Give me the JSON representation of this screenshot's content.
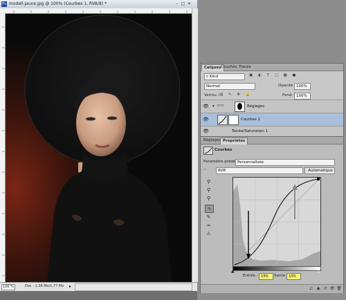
{
  "document": {
    "title": "modell-jaune.jpg @ 100% (Courbes 1, RVB/8) *",
    "app_logo": "Ps",
    "window_controls": [
      "–",
      "□",
      "✕"
    ],
    "zoom": "100 %",
    "doc_info": "Doc : 1,36 Mo/1,77 Mo"
  },
  "layers_panel": {
    "tabs": [
      "Calques",
      "Couches",
      "Tracés"
    ],
    "active_tab": "Calques",
    "kind_filter": "Kind",
    "blend_mode": "Normal",
    "opacity_label": "Opacité :",
    "opacity_value": "100%",
    "lock_label": "Verrou :",
    "fill_label": "Fond :",
    "fill_value": "100%",
    "layers": [
      {
        "name": "Réglages",
        "type": "group",
        "selected": false
      },
      {
        "name": "Courbes 1",
        "type": "adjustment",
        "selected": true
      },
      {
        "name": "Teinte/Saturation 1",
        "type": "adjustment",
        "selected": false
      }
    ]
  },
  "properties_panel": {
    "tabs": [
      "Réglages",
      "Propriétés"
    ],
    "active_tab": "Propriétés",
    "adjustment_name": "Courbes",
    "preset_label": "Paramètre prédéfini :",
    "preset_value": "Personnalisée",
    "channel_value": "RVB",
    "auto_button": "Automatique",
    "input_label": "Entrée :",
    "input_value": "155",
    "output_label": "Sortie :",
    "output_value": "155"
  },
  "colors": {
    "panel_bg": "#c8c8c8",
    "selected_layer": "#a8bfdc",
    "field_highlight": "#f5f177"
  },
  "icons": [
    "ps-logo-icon",
    "eye-icon",
    "folder-icon",
    "layer-mask-icon",
    "curves-icon",
    "sample-shadow-icon",
    "sample-midtone-icon",
    "sample-highlight-icon",
    "curve-draw-icon",
    "pencil-icon",
    "smooth-icon",
    "clip-icon",
    "visibility-icon",
    "reset-icon",
    "trash-icon"
  ]
}
